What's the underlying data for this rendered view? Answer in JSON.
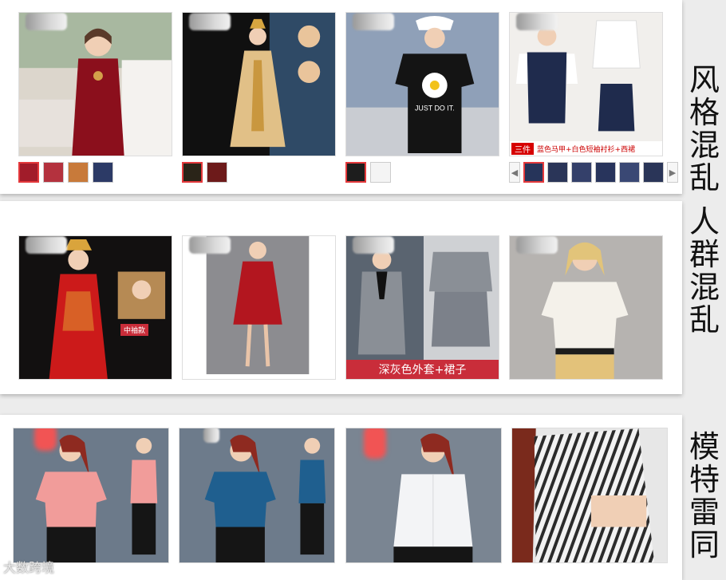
{
  "labels": {
    "style_chaos": "风格混乱",
    "crowd_chaos": "人群混乱",
    "model_same": "模特雷同"
  },
  "row1": {
    "img4_caption_tag": "三件",
    "img4_caption_text": "蓝色马甲+白色短袖衬衫+西裙",
    "tshirt_print": "JUST DO IT."
  },
  "row2": {
    "img1_banner": "中袖款",
    "img3_caption": "深灰色外套+裙子"
  },
  "watermark": "大数跨境",
  "colors": {
    "accent_red": "#c92d3a",
    "select_red": "#e4393c"
  }
}
